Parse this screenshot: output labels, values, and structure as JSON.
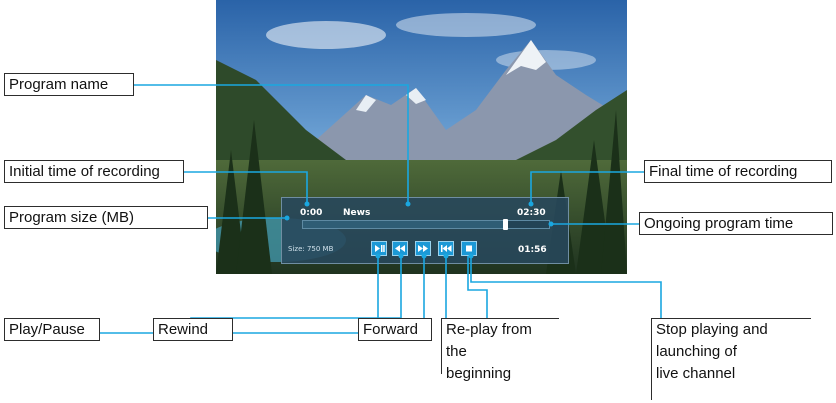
{
  "player": {
    "start_time": "0:00",
    "program_name": "News",
    "end_time": "02:30",
    "size": "Size: 750 MB",
    "ongoing_time": "01:56",
    "progress": 0.82
  },
  "labels": {
    "program_name": "Program name",
    "initial_time": "Initial time of recording",
    "program_size": "Program size (MB)",
    "play_pause": "Play/Pause",
    "rewind": "Rewind",
    "forward": "Forward",
    "replay": "Re-play from the beginning",
    "replay_line1": "Re-play from the",
    "replay_line2": "beginning",
    "final_time": "Final time of recording",
    "ongoing_time": "Ongoing program time",
    "stop_line1": "Stop playing and",
    "stop_line2": "launching of",
    "stop_line3": "live channel"
  },
  "icons": [
    "play-pause-icon",
    "rewind-icon",
    "forward-icon",
    "replay-icon",
    "stop-icon"
  ],
  "colors": {
    "callout_line": "#1aa7e0",
    "button": "#1c99d6",
    "player_panel": "#28485c"
  }
}
